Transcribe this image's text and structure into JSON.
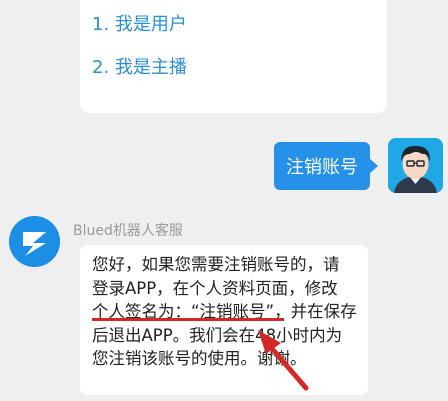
{
  "top_bubble": {
    "option_1": "1. 我是用户",
    "option_2": "2. 我是主播"
  },
  "user_message": {
    "text": "注销账号",
    "bubble_color": "#2591e8"
  },
  "bot": {
    "name": "Blued机器人客服",
    "avatar_color": "#1d8ee6",
    "message_lines": [
      "您好，如果您需要注销账号的，请",
      "登录APP，在个人资料页面，修改",
      "个人签名为：“注销账号”，并在保存",
      "后退出APP。我们会在48小时内为",
      "您注销该账号的使用。谢谢。"
    ]
  },
  "annotation": {
    "color": "#d42828"
  }
}
